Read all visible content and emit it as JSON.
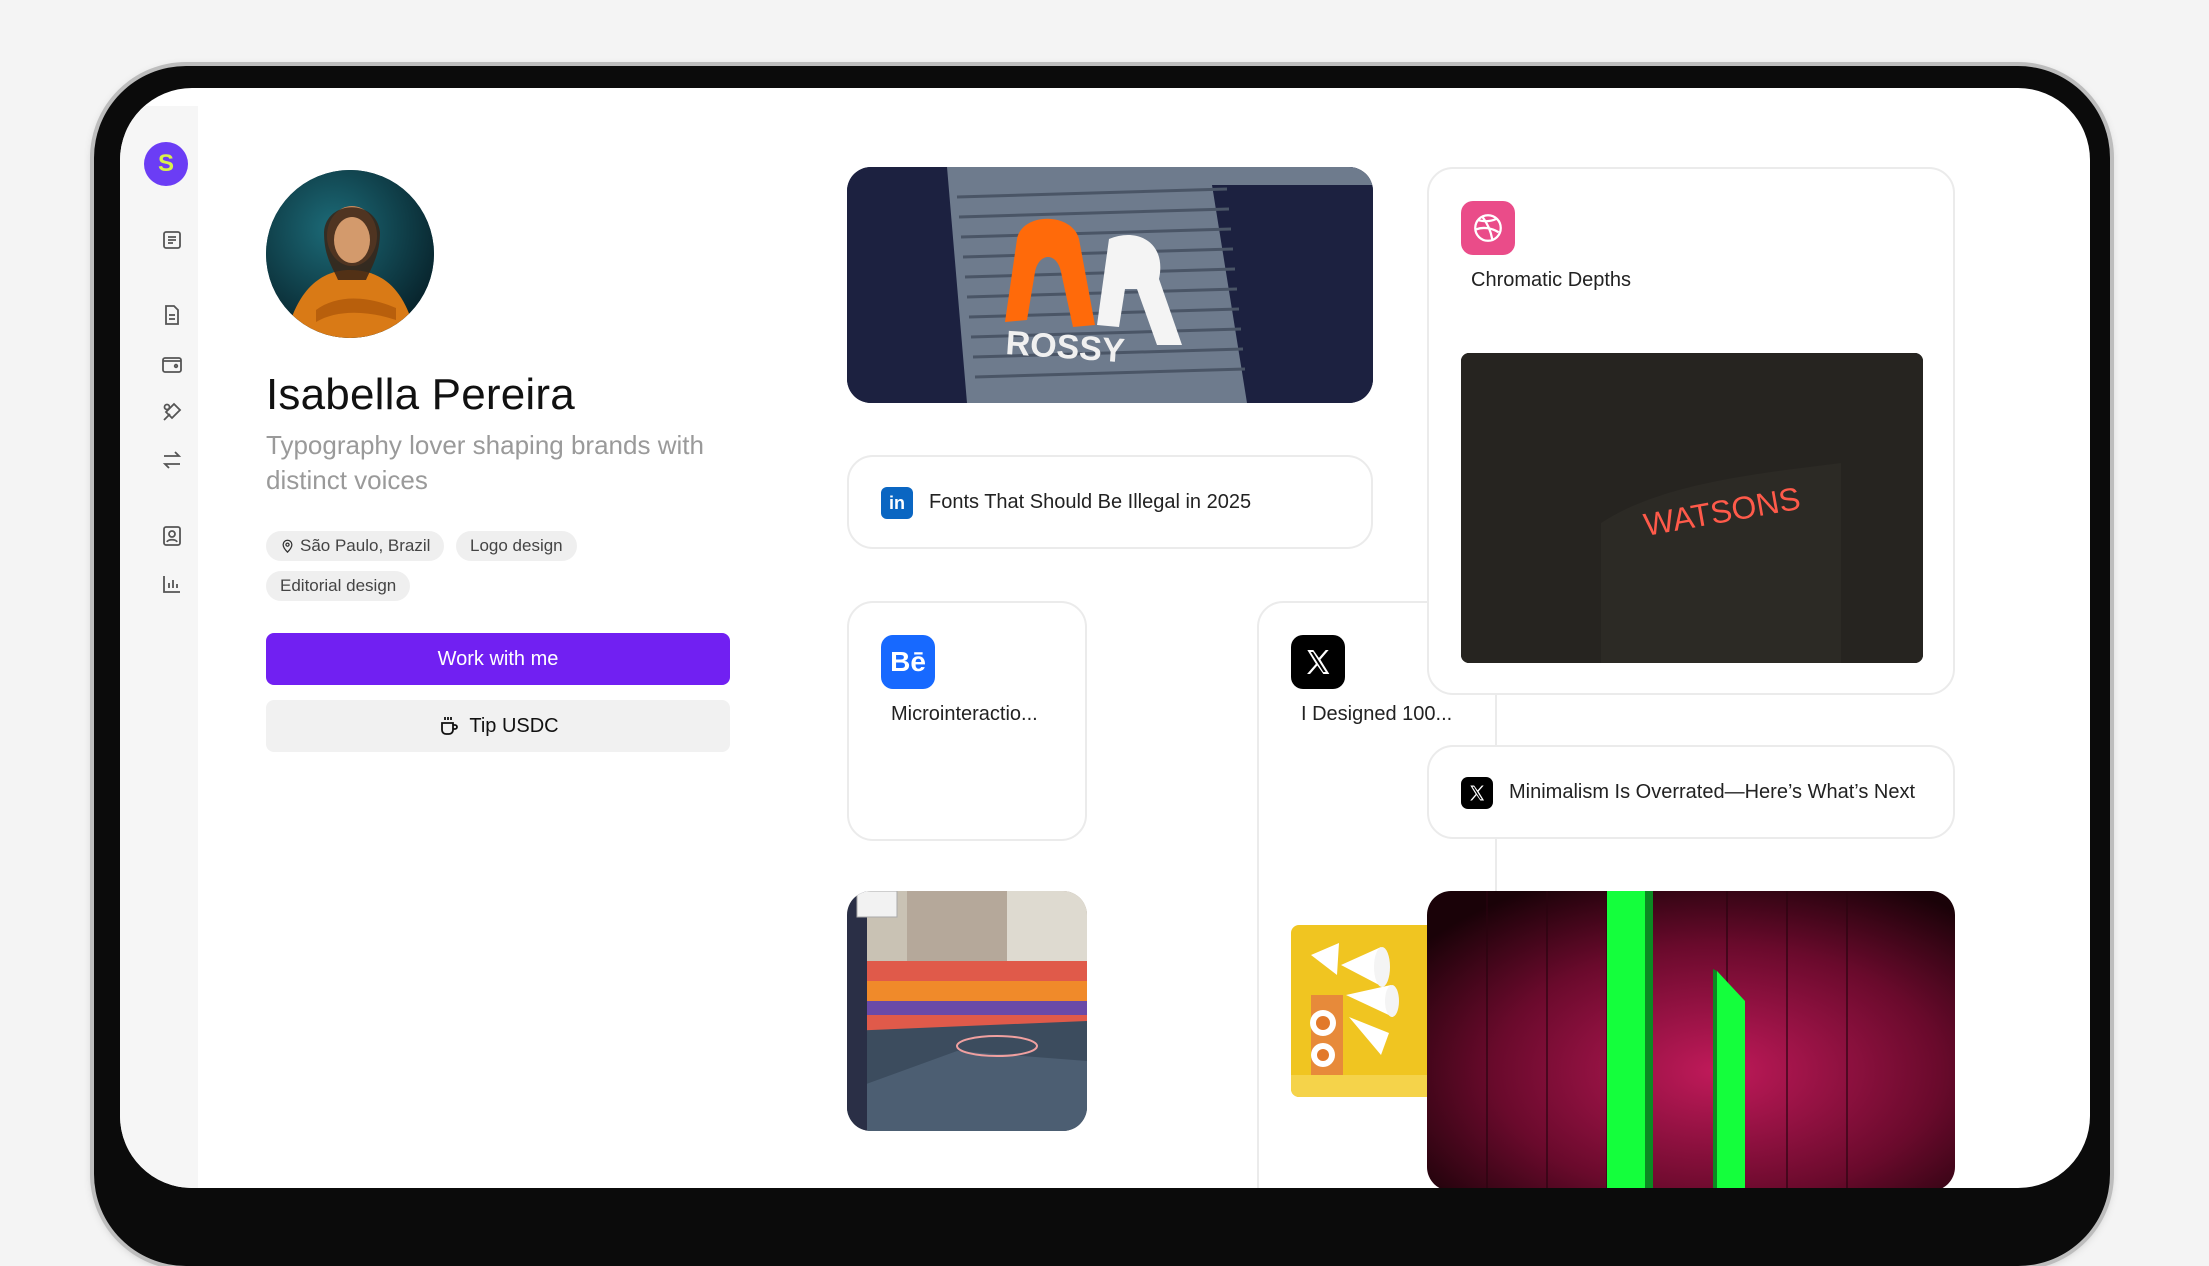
{
  "profile": {
    "name": "Isabella Pereira",
    "bio": "Typography lover shaping brands with distinct voices",
    "tags": [
      "São Paulo, Brazil",
      "Logo design",
      "Editorial design"
    ],
    "cta_primary": "Work with me",
    "cta_secondary": "Tip USDC"
  },
  "sidebar": {
    "logo_letter": "S",
    "icons": [
      "notes-icon",
      "document-icon",
      "wallet-icon",
      "design-tools-icon",
      "swap-icon",
      "contact-card-icon",
      "analytics-icon"
    ]
  },
  "cards": {
    "rossy_sign_text": "ROSSY",
    "linkedin_title": "Fonts That Should Be Illegal in 2025",
    "behance_title": "Microinteractio...",
    "x_tile_title": "I Designed 100...",
    "dribbble_title": "Chromatic Depths",
    "watsons_sign_text": "WATSONS",
    "x_row_title": "Minimalism Is Overrated—Here’s What’s Next"
  },
  "colors": {
    "accent": "#7120f2",
    "logo": "#6b3df5",
    "linkedin": "#0a66c2",
    "behance": "#1769ff",
    "dribbble": "#ea4c89",
    "x": "#000000"
  }
}
